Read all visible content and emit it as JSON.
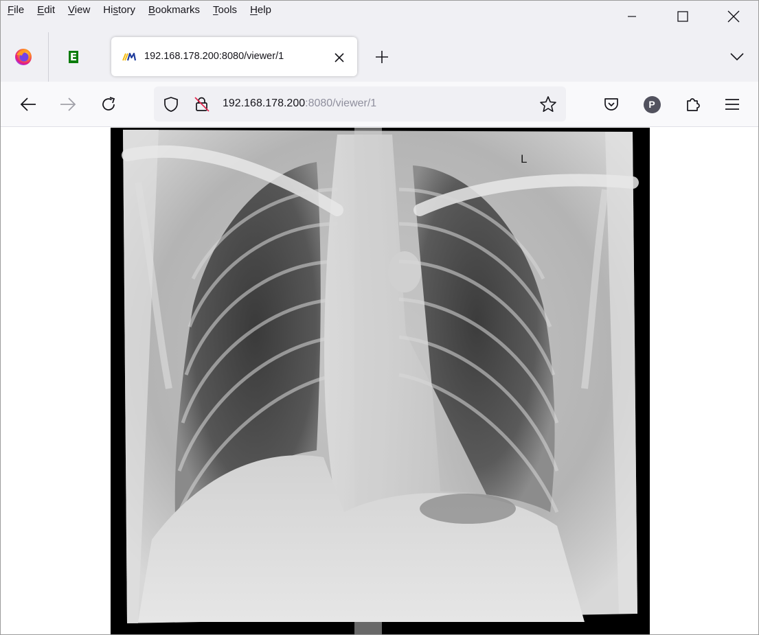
{
  "menubar": {
    "items": [
      {
        "label_prefix": "",
        "mnemonic": "F",
        "label_rest": "ile"
      },
      {
        "label_prefix": "",
        "mnemonic": "E",
        "label_rest": "dit"
      },
      {
        "label_prefix": "",
        "mnemonic": "V",
        "label_rest": "iew"
      },
      {
        "label_prefix": "Hi",
        "mnemonic": "s",
        "label_rest": "tory"
      },
      {
        "label_prefix": "",
        "mnemonic": "B",
        "label_rest": "ookmarks"
      },
      {
        "label_prefix": "",
        "mnemonic": "T",
        "label_rest": "ools"
      },
      {
        "label_prefix": "",
        "mnemonic": "H",
        "label_rest": "elp"
      }
    ]
  },
  "window_controls": {
    "minimize_icon": "minimize-icon",
    "maximize_icon": "maximize-icon",
    "close_icon": "close-icon"
  },
  "tabs": {
    "pinned": [
      {
        "icon": "firefox-icon"
      },
      {
        "icon": "e-favicon-icon",
        "glyph": "E",
        "color": "#0a7c0a"
      }
    ],
    "active": {
      "title": "192.168.178.200:8080/viewer/1",
      "favicon": "im-favicon-icon"
    },
    "new_tab_icon": "plus-icon",
    "list_all_tabs_icon": "chevron-down-icon"
  },
  "navbar": {
    "back_icon": "back-arrow-icon",
    "forward_icon": "forward-arrow-icon",
    "reload_icon": "reload-icon",
    "url": {
      "host": "192.168.178.200",
      "rest": ":8080/viewer/1"
    },
    "profile_initial": "P"
  },
  "viewer": {
    "orientation_marker": "L"
  },
  "colors": {
    "chrome_bg": "#f0f0f4",
    "navbar_bg": "#f9f9fb",
    "text": "#15141a",
    "url_dim": "#8f8f9d",
    "viewer_bg": "#000000"
  }
}
